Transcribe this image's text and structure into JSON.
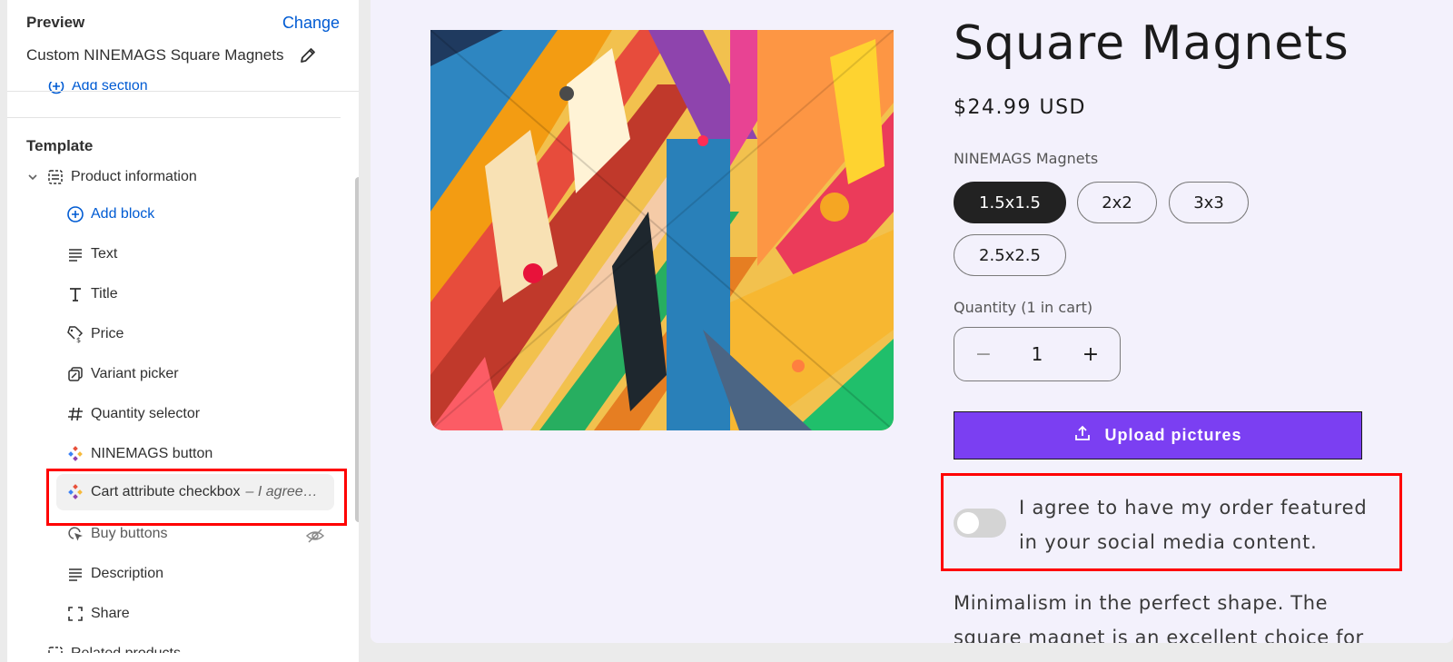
{
  "sidebar": {
    "preview_label": "Preview",
    "change_label": "Change",
    "product_name": "Custom NINEMAGS Square Magnets",
    "add_section_label": "Add section",
    "template_label": "Template",
    "section_title": "Product information",
    "add_block_label": "Add block",
    "blocks": [
      {
        "label": "Text",
        "icon": "text-lines-icon"
      },
      {
        "label": "Title",
        "icon": "title-t-icon"
      },
      {
        "label": "Price",
        "icon": "price-tag-icon"
      },
      {
        "label": "Variant picker",
        "icon": "variant-picker-icon"
      },
      {
        "label": "Quantity selector",
        "icon": "hash-icon"
      },
      {
        "label": "NINEMAGS button",
        "icon": "app-block-icon"
      },
      {
        "label": "Cart attribute checkbox",
        "suffix": "– I agree…",
        "icon": "app-block-icon"
      },
      {
        "label": "Buy buttons",
        "icon": "cursor-click-icon"
      },
      {
        "label": "Description",
        "icon": "text-lines-icon"
      },
      {
        "label": "Share",
        "icon": "share-frame-icon"
      }
    ],
    "next_section_label": "Related products"
  },
  "product": {
    "title": "Square Magnets",
    "price": "$24.99 USD",
    "variant_label": "NINEMAGS Magnets",
    "variants": [
      "1.5x1.5",
      "2x2",
      "3x3",
      "2.5x2.5"
    ],
    "selected_variant": "1.5x1.5",
    "quantity_label": "Quantity (1 in cart)",
    "quantity_value": "1",
    "minus": "−",
    "plus": "+",
    "upload_label": "Upload pictures",
    "agree_text": "I agree to have my order featured in your social media content.",
    "description": "Minimalism in the perfect shape. The square magnet is an excellent choice for"
  },
  "colors": {
    "accent_link": "#005bd3",
    "upload_button": "#7b3ff2",
    "highlight": "#ff0000",
    "canvas_bg": "#f3f1fc"
  }
}
